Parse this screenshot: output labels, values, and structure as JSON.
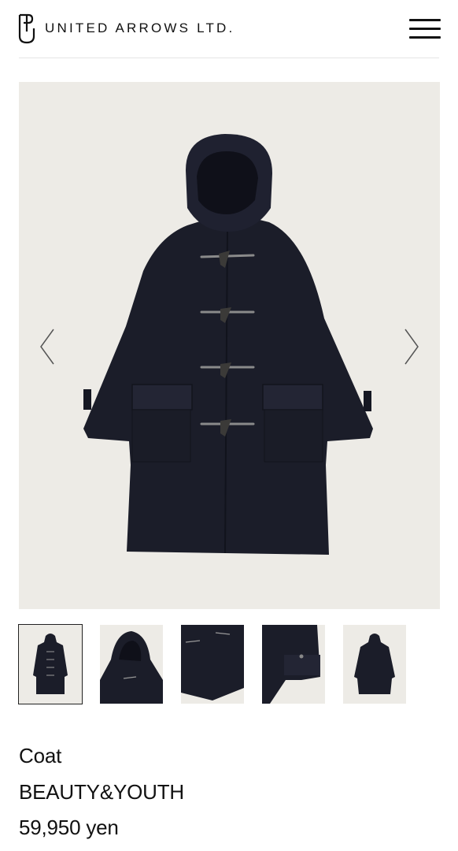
{
  "header": {
    "logo_text": "UNITED ARROWS LTD.",
    "logo_icon": "ua-monogram-icon",
    "menu_icon": "hamburger-menu-icon"
  },
  "gallery": {
    "prev_icon": "chevron-left-icon",
    "next_icon": "chevron-right-icon",
    "main_image": "navy duffle coat front view",
    "thumbnail_count": 5,
    "active_thumbnail": 1
  },
  "product": {
    "name": "Coat",
    "brand": "BEAUTY&YOUTH",
    "price": "59,950 yen"
  },
  "colors": {
    "background": "#ffffff",
    "image_bg": "#edebe6",
    "coat": "#1b1d29",
    "text": "#111111"
  }
}
